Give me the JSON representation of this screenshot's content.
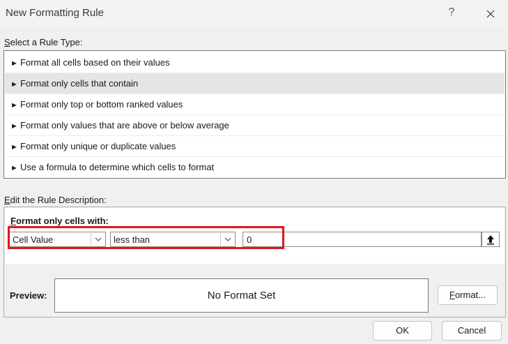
{
  "dialog": {
    "title": "New Formatting Rule",
    "help_label": "?"
  },
  "rule_type": {
    "label_accel": "S",
    "label_rest": "elect a Rule Type:",
    "items": [
      {
        "label": "Format all cells based on their values",
        "selected": false
      },
      {
        "label": "Format only cells that contain",
        "selected": true
      },
      {
        "label": "Format only top or bottom ranked values",
        "selected": false
      },
      {
        "label": "Format only values that are above or below average",
        "selected": false
      },
      {
        "label": "Format only unique or duplicate values",
        "selected": false
      },
      {
        "label": "Use a formula to determine which cells to format",
        "selected": false
      }
    ]
  },
  "description": {
    "label_accel": "E",
    "label_rest": "dit the Rule Description:",
    "format_label_accel": "F",
    "format_label_rest": "ormat only cells with:",
    "condition_type": "Cell Value",
    "operator": "less than",
    "value": "0",
    "preview_label": "Preview:",
    "preview_text": "No Format Set",
    "format_button_accel": "F",
    "format_button_rest": "ormat..."
  },
  "footer": {
    "ok_label": "OK",
    "cancel_label": "Cancel"
  },
  "colors": {
    "highlight": "#e0161e",
    "selected_row": "#e5e5e5"
  }
}
